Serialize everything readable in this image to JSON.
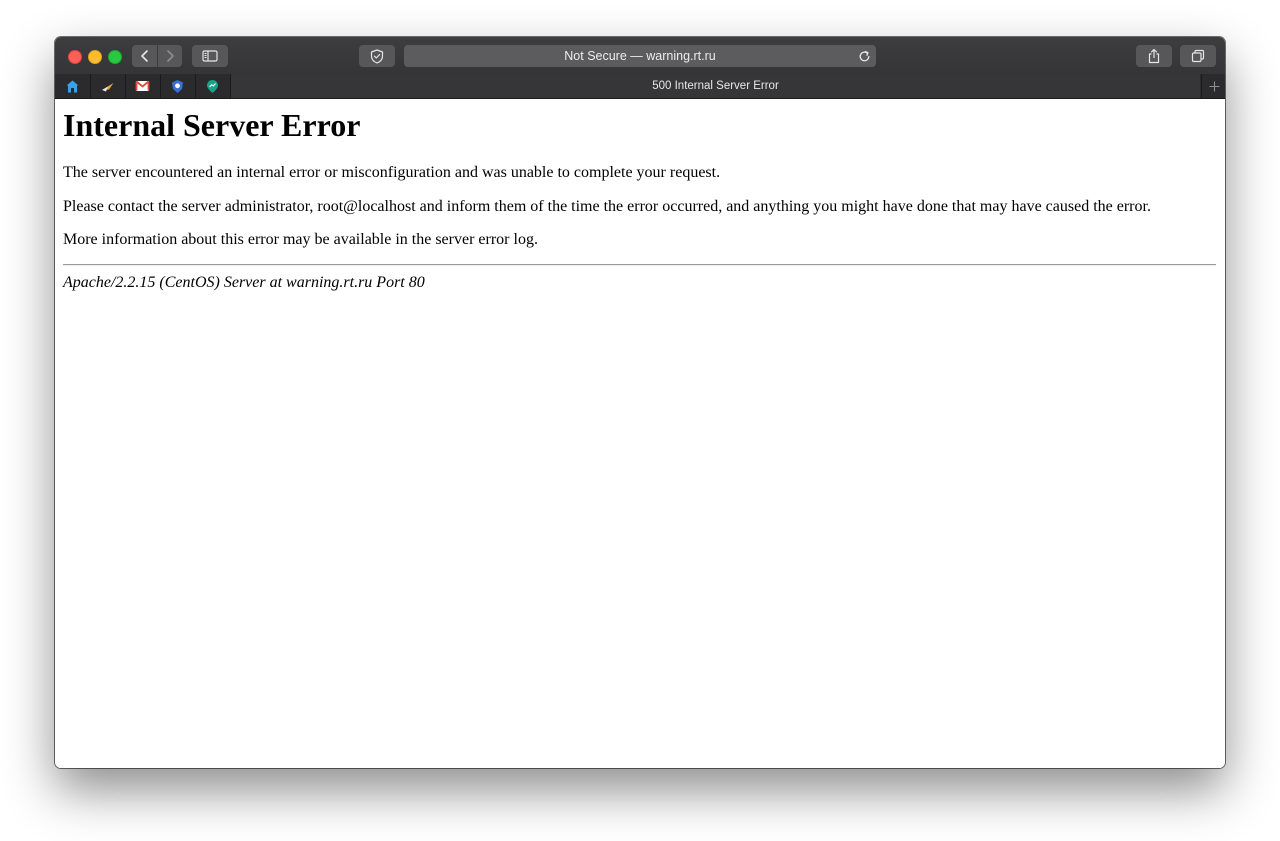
{
  "browser": {
    "address_bar": {
      "text": "Not Secure — warning.rt.ru"
    },
    "tabs": {
      "active_title": "500 Internal Server Error",
      "pinned": [
        {
          "icon": "house-icon",
          "color": "#3aa0e8"
        },
        {
          "icon": "plane-icon",
          "color": "#f2a33a"
        },
        {
          "icon": "gmail-icon",
          "color": "#e04a3f"
        },
        {
          "icon": "shield-badge-icon",
          "color": "#3b6fd6"
        },
        {
          "icon": "map-pin-icon",
          "color": "#1aa389"
        }
      ]
    },
    "colors": {
      "traffic_close": "#fe5f57",
      "traffic_minimize": "#febc2e",
      "traffic_maximize": "#28c840",
      "chrome": "#3d3d3f"
    }
  },
  "page": {
    "title": "Internal Server Error",
    "paragraphs": [
      "The server encountered an internal error or misconfiguration and was unable to complete your request.",
      "Please contact the server administrator, root@localhost and inform them of the time the error occurred, and anything you might have done that may have caused the error.",
      "More information about this error may be available in the server error log."
    ],
    "footer": "Apache/2.2.15 (CentOS) Server at warning.rt.ru Port 80"
  }
}
